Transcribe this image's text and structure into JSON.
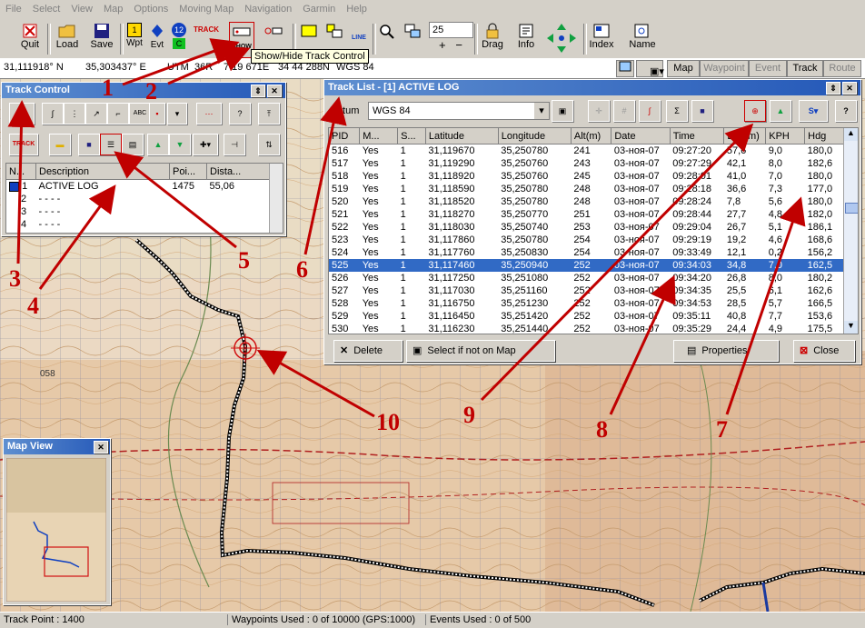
{
  "menu": [
    "File",
    "Select",
    "View",
    "Map",
    "Options",
    "Moving Map",
    "Navigation",
    "Garmin",
    "Help"
  ],
  "toolbar": {
    "quit": "Quit",
    "load": "Load",
    "save": "Save",
    "wpt": "Wpt",
    "evt": "Evt",
    "drag": "Drag",
    "info": "Info",
    "index": "Index",
    "name": "Name",
    "zoom_value": "25",
    "track_icon_text": "TRACK",
    "show_icon_text": "SHOW",
    "tooltip": "Show/Hide Track Control",
    "line_text": "LINE",
    "wpt_badge": "1",
    "evt_badge": "12",
    "c_badge": "C"
  },
  "coords": {
    "lat": "31,111918° N",
    "lon": "35,303437° E",
    "utm_label": "UTM",
    "zone": "36R",
    "easting": "7 19 671E",
    "northing": "34 44 288N",
    "datum": "WGS 84"
  },
  "nav_tabs": [
    "Map",
    "Waypoint",
    "Event",
    "Track",
    "Route"
  ],
  "track_control": {
    "title": "Track Control",
    "columns": [
      "N...",
      "Description",
      "Poi...",
      "Dista..."
    ],
    "rows": [
      {
        "n": "1",
        "desc": "ACTIVE LOG",
        "points": "1475",
        "dist": "55,06"
      },
      {
        "n": "2",
        "desc": "- - - -",
        "points": "",
        "dist": ""
      },
      {
        "n": "3",
        "desc": "- - - -",
        "points": "",
        "dist": ""
      },
      {
        "n": "4",
        "desc": "- - - -",
        "points": "",
        "dist": ""
      }
    ],
    "btn_abc": "ABC",
    "btn_track": "TRACK",
    "btn_help": "?"
  },
  "track_list": {
    "title": "Track List - [1] ACTIVE LOG",
    "datum_label": "Datum",
    "datum_value": "WGS 84",
    "columns": [
      "PID",
      "M...",
      "S...",
      "Latitude",
      "Longitude",
      "Alt(m)",
      "Date",
      "Time",
      "Dist(m)",
      "KPH",
      "Hdg"
    ],
    "rows": [
      [
        "516",
        "Yes",
        "1",
        "31,119670",
        "35,250780",
        "241",
        "03-ноя-07",
        "09:27:20",
        "57,6",
        "9,0",
        "180,0"
      ],
      [
        "517",
        "Yes",
        "1",
        "31,119290",
        "35,250760",
        "243",
        "03-ноя-07",
        "09:27:29",
        "42,1",
        "8,0",
        "182,6"
      ],
      [
        "518",
        "Yes",
        "1",
        "31,118920",
        "35,250760",
        "245",
        "03-ноя-07",
        "09:28:01",
        "41,0",
        "7,0",
        "180,0"
      ],
      [
        "519",
        "Yes",
        "1",
        "31,118590",
        "35,250780",
        "248",
        "03-ноя-07",
        "09:28:18",
        "36,6",
        "7,3",
        "177,0"
      ],
      [
        "520",
        "Yes",
        "1",
        "31,118520",
        "35,250780",
        "248",
        "03-ноя-07",
        "09:28:24",
        "7,8",
        "5,6",
        "180,0"
      ],
      [
        "521",
        "Yes",
        "1",
        "31,118270",
        "35,250770",
        "251",
        "03-ноя-07",
        "09:28:44",
        "27,7",
        "4,8",
        "182,0"
      ],
      [
        "522",
        "Yes",
        "1",
        "31,118030",
        "35,250740",
        "253",
        "03-ноя-07",
        "09:29:04",
        "26,7",
        "5,1",
        "186,1"
      ],
      [
        "523",
        "Yes",
        "1",
        "31,117860",
        "35,250780",
        "254",
        "03-ноя-07",
        "09:29:19",
        "19,2",
        "4,6",
        "168,6"
      ],
      [
        "524",
        "Yes",
        "1",
        "31,117760",
        "35,250830",
        "254",
        "03-ноя-07",
        "09:33:49",
        "12,1",
        "0,2",
        "156,2"
      ],
      [
        "525",
        "Yes",
        "1",
        "31,117460",
        "35,250940",
        "252",
        "03-ноя-07",
        "09:34:03",
        "34,8",
        "7,0",
        "162,5"
      ],
      [
        "526",
        "Yes",
        "1",
        "31,117250",
        "35,251080",
        "252",
        "03-ноя-07",
        "09:34:20",
        "26,8",
        "8,0",
        "180,2"
      ],
      [
        "527",
        "Yes",
        "1",
        "31,117030",
        "35,251160",
        "252",
        "03-ноя-07",
        "09:34:35",
        "25,5",
        "6,1",
        "162,6"
      ],
      [
        "528",
        "Yes",
        "1",
        "31,116750",
        "35,251230",
        "252",
        "03-ноя-07",
        "09:34:53",
        "28,5",
        "5,7",
        "166,5"
      ],
      [
        "529",
        "Yes",
        "1",
        "31,116450",
        "35,251420",
        "252",
        "03-ноя-07",
        "09:35:11",
        "40,8",
        "7,7",
        "153,6"
      ],
      [
        "530",
        "Yes",
        "1",
        "31,116230",
        "35,251440",
        "252",
        "03-ноя-07",
        "09:35:29",
        "24,4",
        "4,9",
        "175,5"
      ]
    ],
    "selected_row": 9,
    "btn_delete": "Delete",
    "btn_select_not_on_map": "Select if not on Map",
    "btn_properties": "Properties",
    "btn_close": "Close"
  },
  "map_view": {
    "title": "Map View"
  },
  "map_labels": {
    "grid_058": "058"
  },
  "status": {
    "track_point": "Track Point : 1400",
    "waypoints": "Waypoints Used : 0 of 10000  (GPS:1000)",
    "events": "Events Used : 0 of 500"
  },
  "annotations": [
    "1",
    "2",
    "3",
    "4",
    "5",
    "6",
    "7",
    "8",
    "9",
    "10"
  ],
  "colors": {
    "title_gradient_start": "#5f8fd0",
    "title_gradient_end": "#2458b8",
    "selection": "#316ac5",
    "annotation_red": "#c00000",
    "map_base": "#ebd9c3",
    "track_line": "#ffffff"
  }
}
